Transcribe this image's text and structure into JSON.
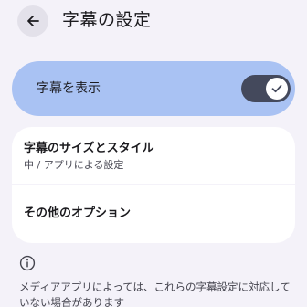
{
  "header": {
    "title": "字幕の設定"
  },
  "captions_toggle": {
    "label": "字幕を表示",
    "state": "on"
  },
  "options": [
    {
      "title": "字幕のサイズとスタイル",
      "subtitle": "中 / アプリによる設定"
    },
    {
      "title": "その他のオプション"
    }
  ],
  "info": {
    "text": "メディアアプリによっては、これらの字幕設定に対応していない場合があります"
  },
  "colors": {
    "background": "#f4f2f9",
    "toggle_card": "#a9c2f3",
    "switch_track": "#44495c"
  }
}
